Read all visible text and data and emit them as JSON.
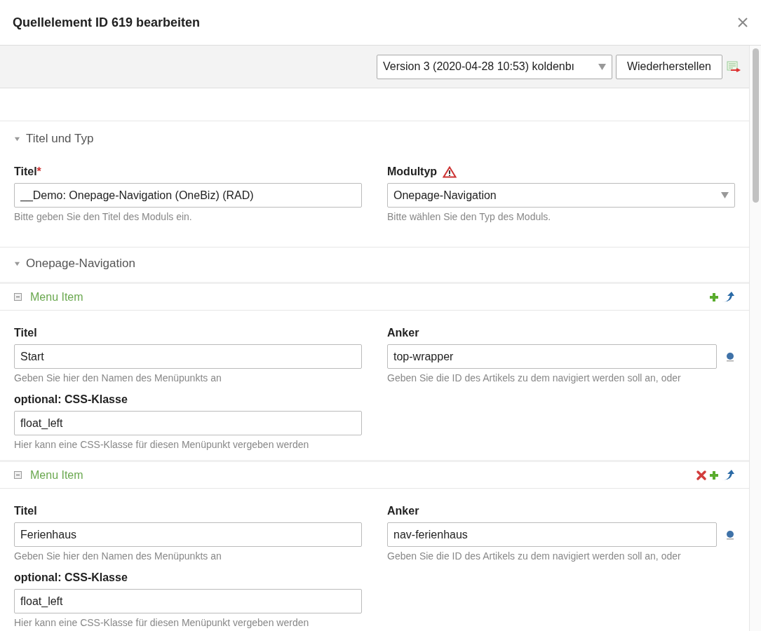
{
  "dialog": {
    "title": "Quellelement ID 619 bearbeiten"
  },
  "toolbar": {
    "version_select": "Version 3 (2020-04-28 10:53) koldenbı",
    "restore_button": "Wiederherstellen"
  },
  "section_title_type": {
    "heading": "Titel und Typ",
    "expanded": true,
    "title_field": {
      "label": "Titel",
      "required_mark": "*",
      "value": "__Demo: Onepage-Navigation (OneBiz) (RAD)",
      "help": "Bitte geben Sie den Titel des Moduls ein."
    },
    "type_field": {
      "label": "Modultyp",
      "value": "Onepage-Navigation",
      "help": "Bitte wählen Sie den Typ des Moduls."
    }
  },
  "section_nav": {
    "heading": "Onepage-Navigation",
    "expanded": true,
    "menu_items": [
      {
        "heading": "Menu Item",
        "removable": false,
        "title_label": "Titel",
        "title_value": "Start",
        "title_help": "Geben Sie hier den Namen des Menüpunkts an",
        "anchor_label": "Anker",
        "anchor_value": "top-wrapper",
        "anchor_help": "Geben Sie die ID des Artikels zu dem navigiert werden soll an, oder",
        "css_label": "optional: CSS-Klasse",
        "css_value": "float_left",
        "css_help": "Hier kann eine CSS-Klasse für diesen Menüpunkt vergeben werden"
      },
      {
        "heading": "Menu Item",
        "removable": true,
        "title_label": "Titel",
        "title_value": "Ferienhaus",
        "title_help": "Geben Sie hier den Namen des Menüpunkts an",
        "anchor_label": "Anker",
        "anchor_value": "nav-ferienhaus",
        "anchor_help": "Geben Sie die ID des Artikels zu dem navigiert werden soll an, oder",
        "css_label": "optional: CSS-Klasse",
        "css_value": "float_left",
        "css_help": "Hier kann eine CSS-Klasse für diesen Menüpunkt vergeben werden"
      }
    ]
  }
}
